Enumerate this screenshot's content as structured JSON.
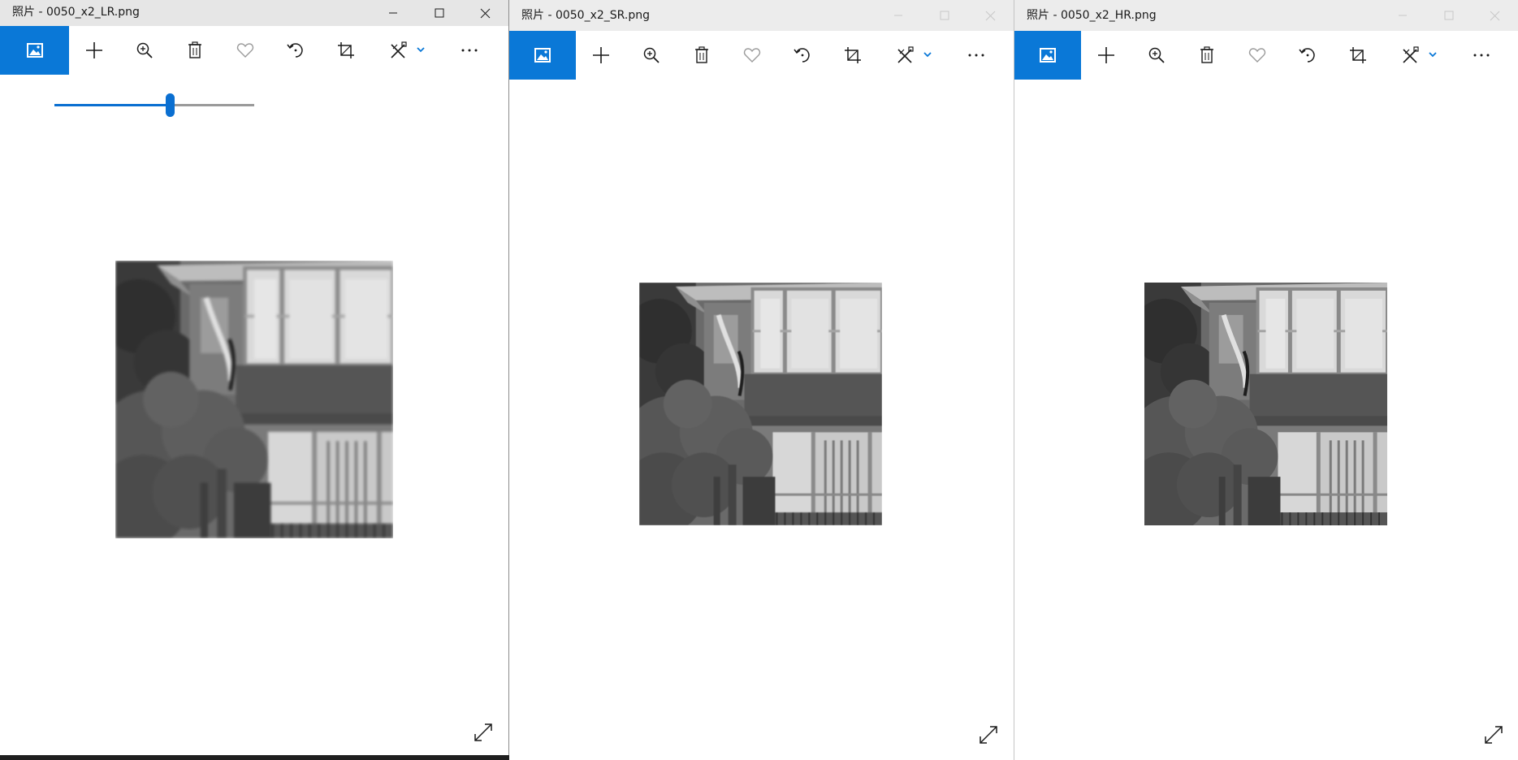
{
  "colors": {
    "accent": "#0a78d7",
    "titlebar": "#e6e6e6",
    "background": "#ffffff"
  },
  "windows": [
    {
      "id": "lr",
      "title": "照片 - 0050_x2_LR.png",
      "active": true,
      "zoom_slider": {
        "value": 0.58
      },
      "toolbar": [
        "photo-home-icon",
        "add-icon",
        "zoom-in-icon",
        "delete-icon",
        "favorite-icon",
        "rotate-icon",
        "crop-icon",
        "edit-icon",
        "chevron-down-icon",
        "more-icon"
      ]
    },
    {
      "id": "sr",
      "title": "照片 - 0050_x2_SR.png",
      "active": false,
      "toolbar": [
        "photo-home-icon",
        "add-icon",
        "zoom-in-icon",
        "delete-icon",
        "favorite-icon",
        "rotate-icon",
        "crop-icon",
        "edit-icon",
        "chevron-down-icon",
        "more-icon"
      ]
    },
    {
      "id": "hr",
      "title": "照片 - 0050_x2_HR.png",
      "active": false,
      "toolbar": [
        "photo-home-icon",
        "add-icon",
        "zoom-in-icon",
        "delete-icon",
        "favorite-icon",
        "rotate-icon",
        "crop-icon",
        "edit-icon",
        "chevron-down-icon",
        "more-icon"
      ]
    }
  ]
}
